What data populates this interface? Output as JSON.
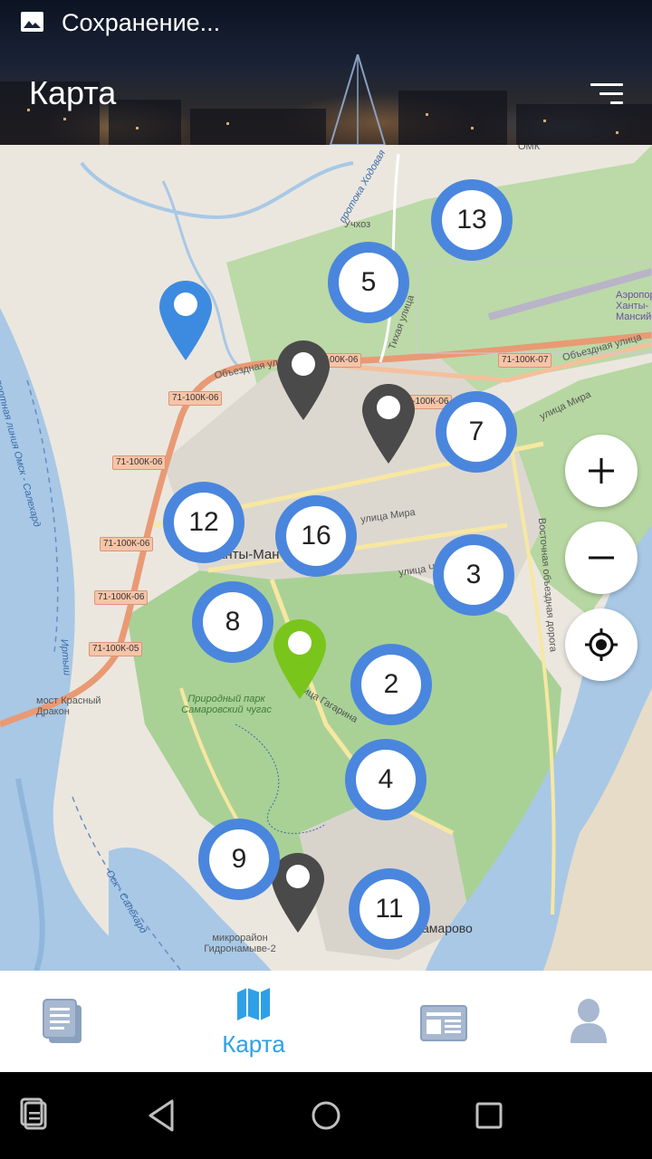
{
  "status_bar": {
    "notification_text": "Сохранение..."
  },
  "header": {
    "title": "Карта"
  },
  "map": {
    "clusters": [
      "13",
      "5",
      "7",
      "12",
      "16",
      "3",
      "8",
      "2",
      "4",
      "9",
      "11"
    ],
    "labels": {
      "uchkhoz": "Учхоз",
      "omk": "ОМК",
      "protoka": "протока Ходовая",
      "obezdnaya_top": "Объездная улица",
      "obezdnaya_right": "Объездная улица",
      "mira_right": "улица Мира",
      "mira_center": "улица Мира",
      "chekhova": "улица Чехова",
      "gagarina": "улица Гагарина",
      "khanty": "анты-Ман",
      "park": "Природный парк Самаровский чугас",
      "bridge": "мост Красный Дракон",
      "airport": "Аэропорт Ханты-Мансийск",
      "samarovo": "амарово",
      "gidronamyve": "микрорайон Гидронамыве-2",
      "irtysh": "Иртыш",
      "vostochnaya": "Восточная объездная дорога",
      "oskalehard": "Оск - Салехард",
      "omsk_salekhard": "водная транспортная линия Омск - Салехард",
      "tikhaya": "Тихая улица"
    },
    "road_badges": [
      "71-100К-06",
      "71-100К-06",
      "71-100К-07",
      "71-100К-06",
      "71-100К-06",
      "71-100К-06",
      "71-100К-05",
      "71-100К-06"
    ]
  },
  "map_controls": {
    "zoom_in": "+",
    "zoom_out": "−"
  },
  "bottom_nav": {
    "active_label": "Карта"
  },
  "colors": {
    "accent": "#2ea0e8",
    "cluster": "#4a86dd",
    "pin_blue": "#3d8be0",
    "pin_gray": "#4a4a4a",
    "pin_green": "#7ac51c"
  }
}
